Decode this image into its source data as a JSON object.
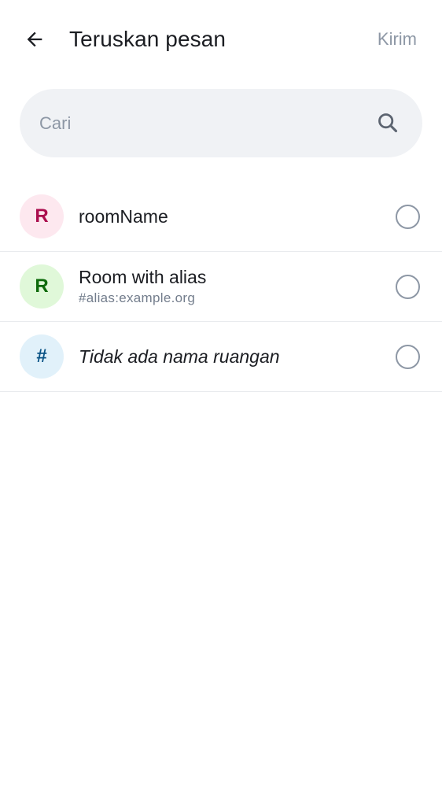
{
  "header": {
    "title": "Teruskan pesan",
    "send_label": "Kirim"
  },
  "search": {
    "placeholder": "Cari",
    "value": ""
  },
  "rooms": [
    {
      "avatar_letter": "R",
      "avatar_bg": "#fde8ef",
      "avatar_fg": "#ab0e4e",
      "name": "roomName",
      "subtitle": "",
      "selected": false
    },
    {
      "avatar_letter": "R",
      "avatar_bg": "#e0f8d9",
      "avatar_fg": "#0e6a0b",
      "name": "Room with alias",
      "subtitle": "#alias:example.org",
      "selected": false
    },
    {
      "avatar_letter": "#",
      "avatar_bg": "#e1f1fa",
      "avatar_fg": "#0b5486",
      "name": "Tidak ada nama ruangan",
      "subtitle": "",
      "selected": false
    }
  ],
  "icons": {
    "back": "arrow-back-icon",
    "search": "search-icon",
    "radio": "radio-unchecked-icon"
  },
  "colors": {
    "text_primary": "#1b1d22",
    "text_secondary": "#737d8c",
    "disabled": "#8d97a5",
    "search_bg": "#f0f2f5",
    "divider": "#e9ebee"
  }
}
